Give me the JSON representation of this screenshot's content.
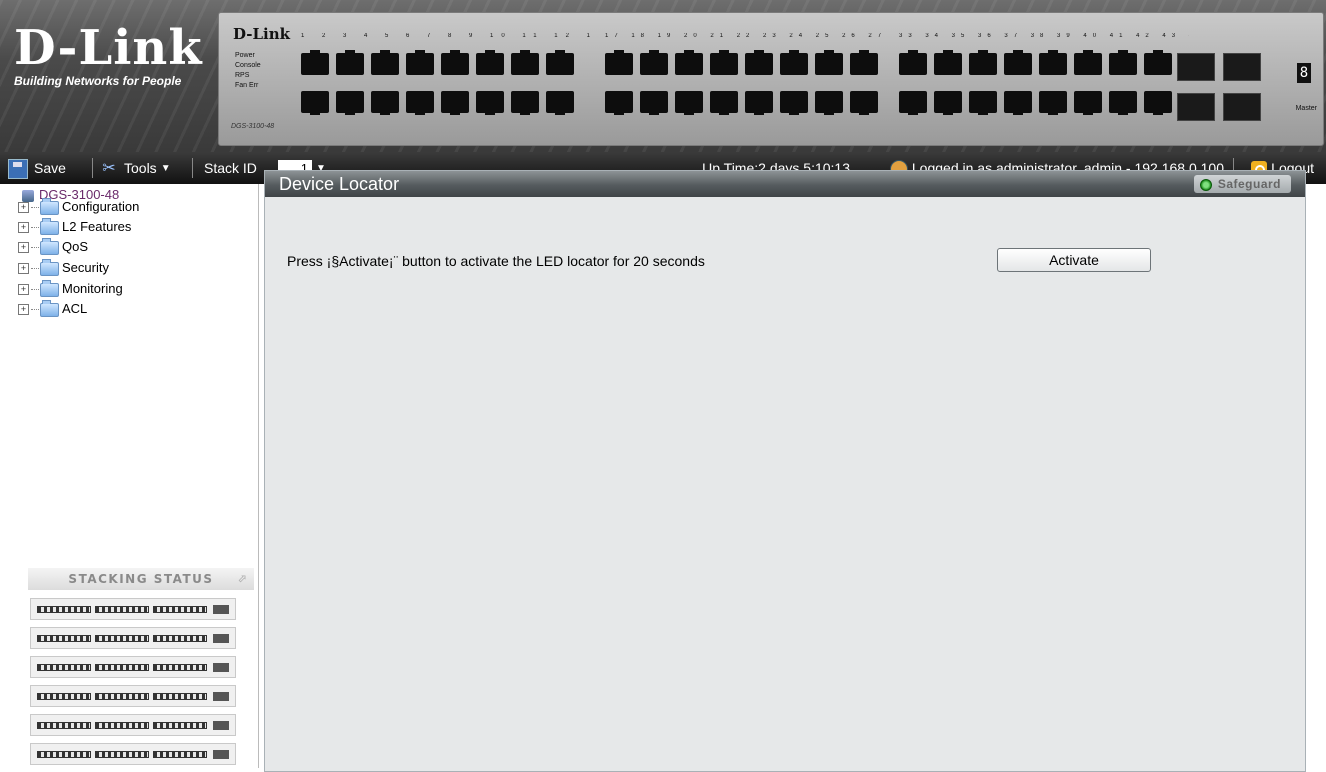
{
  "header": {
    "brand": "D-Link",
    "tagline": "Building Networks for People",
    "device_brand": "D-Link",
    "device_model": "DGS-3100-48",
    "device_leds": [
      "Power",
      "Console",
      "RPS",
      "Fan Err"
    ],
    "port_numbers_1": "1 2 3 4 5 6 7 8 9 10 11 12 13 14 15 16",
    "port_numbers_2": "17 18 19 20 21 22 23 24 25 26 27 28 29 30 31 32",
    "port_numbers_3": "33 34 35 36 37 38 39 40 41 42 43 44 45 46 47 48",
    "master_label": "Master",
    "stack_digit": "8"
  },
  "toolbar": {
    "save_label": "Save",
    "tools_label": "Tools",
    "stack_id_label": "Stack ID",
    "stack_id_value": "1",
    "uptime": "Up Time:2 days 5:10:13",
    "login_info": "Logged in as administrator, admin - 192.168.0.100",
    "logout_label": "Logout"
  },
  "tree": {
    "root": "DGS-3100-48",
    "items": [
      {
        "label": "Configuration"
      },
      {
        "label": "L2 Features"
      },
      {
        "label": "QoS"
      },
      {
        "label": "Security"
      },
      {
        "label": "Monitoring"
      },
      {
        "label": "ACL"
      }
    ]
  },
  "stacking": {
    "title": "Stacking Status",
    "unit_count": 6
  },
  "panel": {
    "title": "Device Locator",
    "safeguard_label": "Safeguard",
    "message": "Press ¡§Activate¡¨ button to activate the LED locator for 20 seconds",
    "activate_label": "Activate"
  },
  "colors": {
    "toolbar_bg": "#111111",
    "panel_bg": "#e6e8e9",
    "tree_root": "#6a2a6a",
    "safeguard_led": "#1b8a1b"
  },
  "icons": [
    "save-icon",
    "tools-icon",
    "user-icon",
    "logout-icon",
    "device-root-icon",
    "folder-icon",
    "expand-icon",
    "safeguard-led-icon"
  ]
}
